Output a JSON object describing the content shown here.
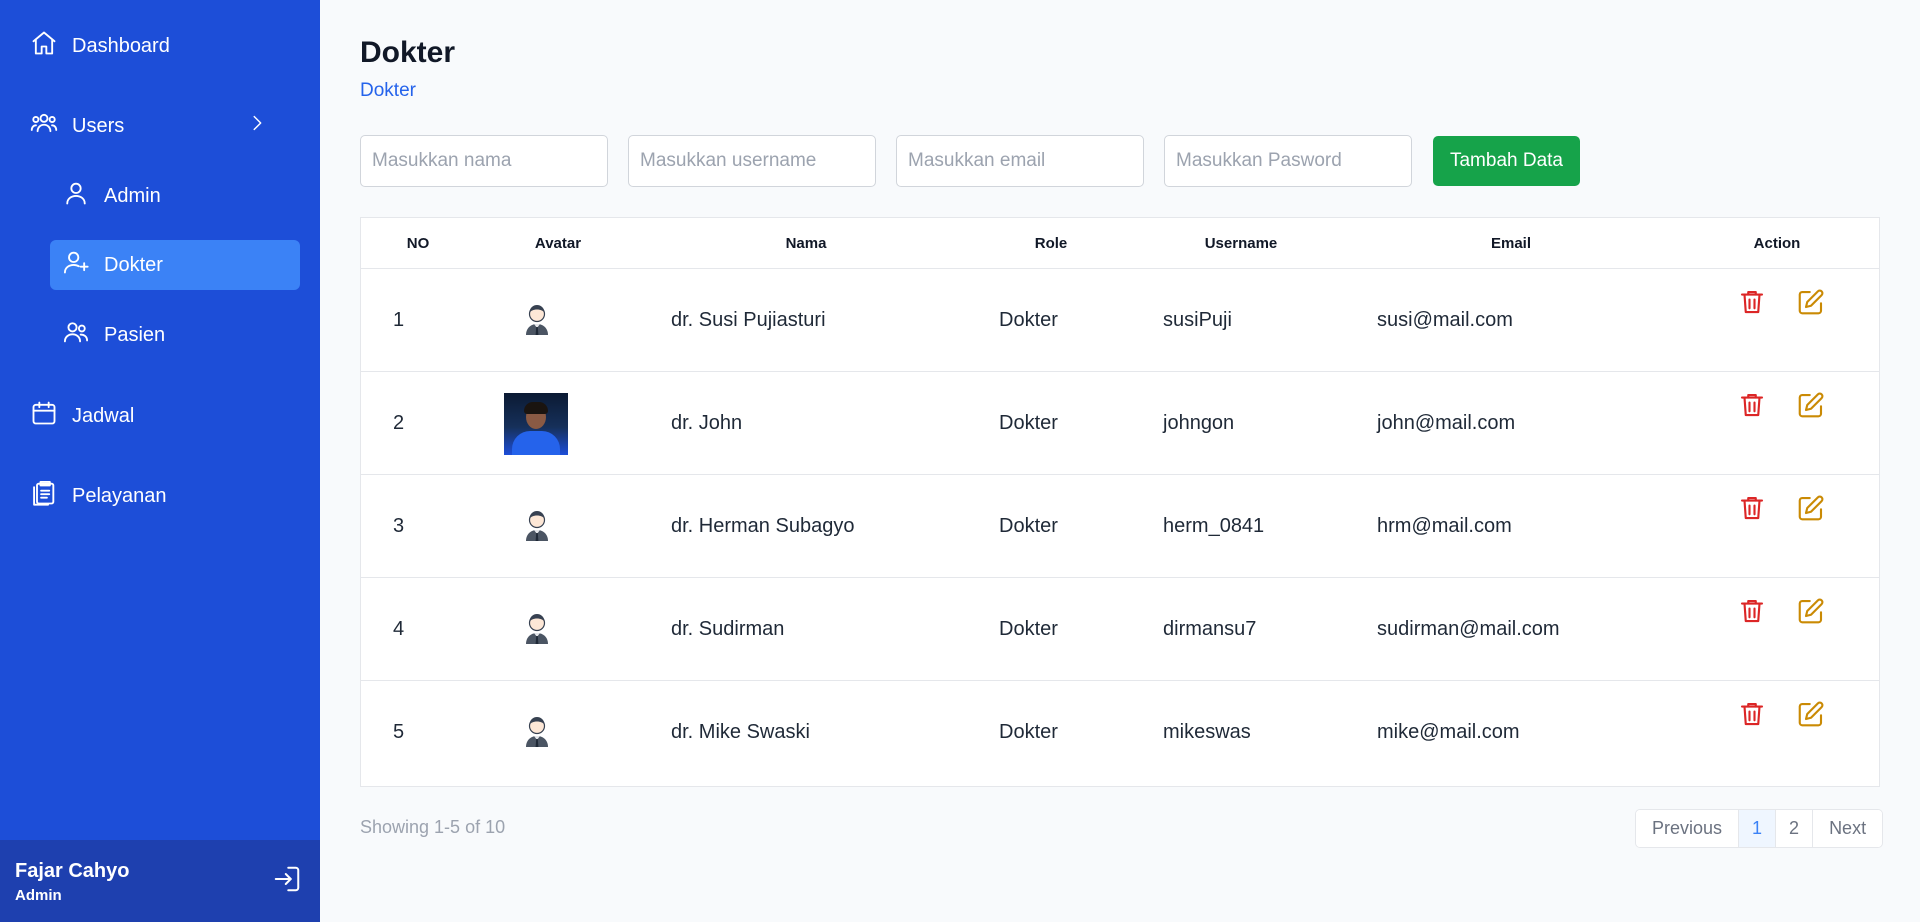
{
  "sidebar": {
    "items": [
      {
        "label": "Dashboard",
        "icon": "home-icon"
      },
      {
        "label": "Users",
        "icon": "users-icon"
      },
      {
        "label": "Admin",
        "icon": "user-icon"
      },
      {
        "label": "Dokter",
        "icon": "user-plus-icon",
        "active": true
      },
      {
        "label": "Pasien",
        "icon": "users-icon"
      },
      {
        "label": "Jadwal",
        "icon": "calendar-icon"
      },
      {
        "label": "Pelayanan",
        "icon": "clipboard-icon"
      }
    ],
    "user": {
      "name": "Fajar Cahyo",
      "role": "Admin"
    }
  },
  "page": {
    "title": "Dokter",
    "breadcrumb": "Dokter"
  },
  "form": {
    "name_placeholder": "Masukkan nama",
    "username_placeholder": "Masukkan username",
    "email_placeholder": "Masukkan email",
    "password_placeholder": "Masukkan Pasword",
    "add_label": "Tambah Data"
  },
  "table": {
    "headers": [
      "NO",
      "Avatar",
      "Nama",
      "Role",
      "Username",
      "Email",
      "Action"
    ],
    "rows": [
      {
        "no": "1",
        "avatar": "default-avatar",
        "nama": "dr. Susi Pujiasturi",
        "role": "Dokter",
        "username": "susiPuji",
        "email": "susi@mail.com"
      },
      {
        "no": "2",
        "avatar": "photo",
        "nama": "dr. John",
        "role": "Dokter",
        "username": "johngon",
        "email": "john@mail.com"
      },
      {
        "no": "3",
        "avatar": "default-avatar",
        "nama": "dr. Herman Subagyo",
        "role": "Dokter",
        "username": "herm_0841",
        "email": "hrm@mail.com"
      },
      {
        "no": "4",
        "avatar": "default-avatar",
        "nama": "dr. Sudirman",
        "role": "Dokter",
        "username": "dirmansu7",
        "email": "sudirman@mail.com"
      },
      {
        "no": "5",
        "avatar": "default-avatar",
        "nama": "dr. Mike Swaski",
        "role": "Dokter",
        "username": "mikeswas",
        "email": "mike@mail.com"
      }
    ]
  },
  "footer": {
    "showing": "Showing 1-5 of 10",
    "previous": "Previous",
    "pages": [
      "1",
      "2"
    ],
    "current_page": "1",
    "next": "Next"
  },
  "colors": {
    "sidebar": "#1d4ed8",
    "sidebar_active": "#3b82f6",
    "user_box": "#1e40af",
    "add_button": "#16a34a",
    "delete": "#dc2626",
    "edit": "#ca8a04"
  }
}
